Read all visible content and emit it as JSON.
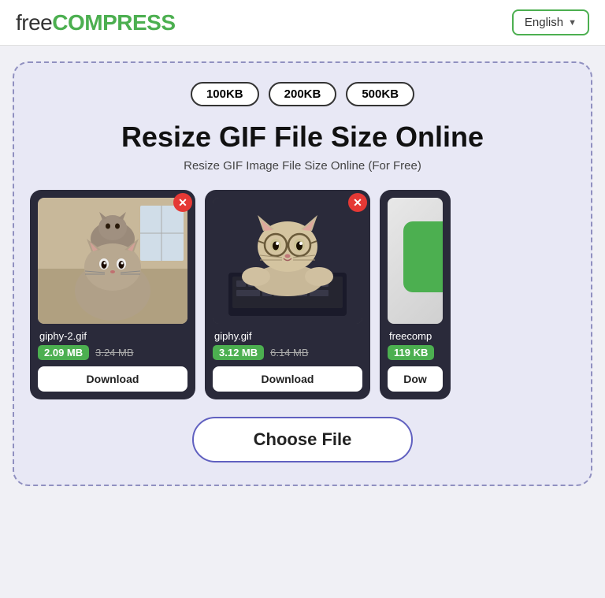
{
  "header": {
    "logo_free": "free",
    "logo_compress": "COMPRESS",
    "lang_label": "English",
    "lang_chevron": "▼"
  },
  "size_buttons": {
    "btn1": "100KB",
    "btn2": "200KB",
    "btn3": "500KB"
  },
  "page": {
    "title": "Resize GIF File Size Online",
    "subtitle": "Resize GIF Image File Size Online (For Free)"
  },
  "cards": [
    {
      "filename": "giphy-2.gif",
      "size_new": "2.09 MB",
      "size_old": "3.24 MB",
      "download_label": "Download"
    },
    {
      "filename": "giphy.gif",
      "size_new": "3.12 MB",
      "size_old": "6.14 MB",
      "download_label": "Download"
    }
  ],
  "partial_card": {
    "filename": "freecomp",
    "size_new": "119 KB",
    "download_label": "Dow"
  },
  "choose_file": {
    "label": "Choose File"
  }
}
